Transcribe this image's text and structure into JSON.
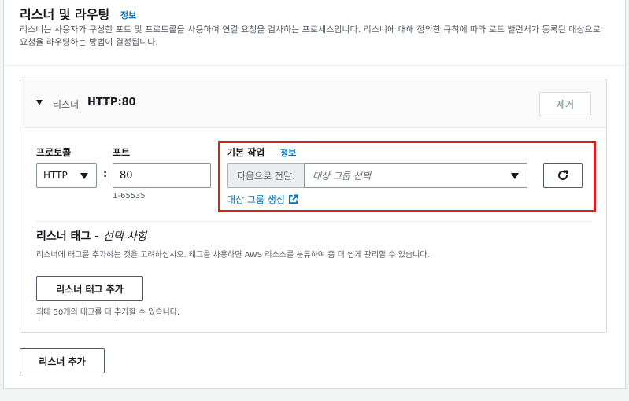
{
  "section": {
    "title": "리스너 및 라우팅",
    "info_label": "정보",
    "description": "리스너는 사용자가 구성한 포트 및 프로토콜을 사용하여 연결 요청을 검사하는 프로세스입니다. 리스너에 대해 정의한 규칙에 따라 로드 밸런서가 등록된 대상으로 요청을 라우팅하는 방법이 결정됩니다."
  },
  "listener": {
    "label": "리스너",
    "name": "HTTP:80",
    "remove_label": "제거",
    "protocol_label": "프로토콜",
    "protocol_value": "HTTP",
    "colon": ":",
    "port_label": "포트",
    "port_value": "80",
    "port_hint": "1-65535",
    "default_action_label": "기본 작업",
    "default_action_info": "정보",
    "forward_prefix": "다음으로 전달:",
    "target_group_placeholder": "대상 그룹 선택",
    "create_target_group_link": "대상 그룹 생성"
  },
  "tags": {
    "title": "리스너 태그 - ",
    "title_optional": "선택 사항",
    "description": "리스너에 태그를 추가하는 것을 고려하십시오. 태그를 사용하면 AWS 리소스를 분류하여 좀 더 쉽게 관리할 수 있습니다.",
    "add_button": "리스너 태그 추가",
    "limit_text": "최대 50개의 태그를 더 추가할 수 있습니다."
  },
  "footer": {
    "add_listener_button": "리스너 추가"
  },
  "colors": {
    "highlight_border": "#e11a1a",
    "link": "#0073bb"
  }
}
